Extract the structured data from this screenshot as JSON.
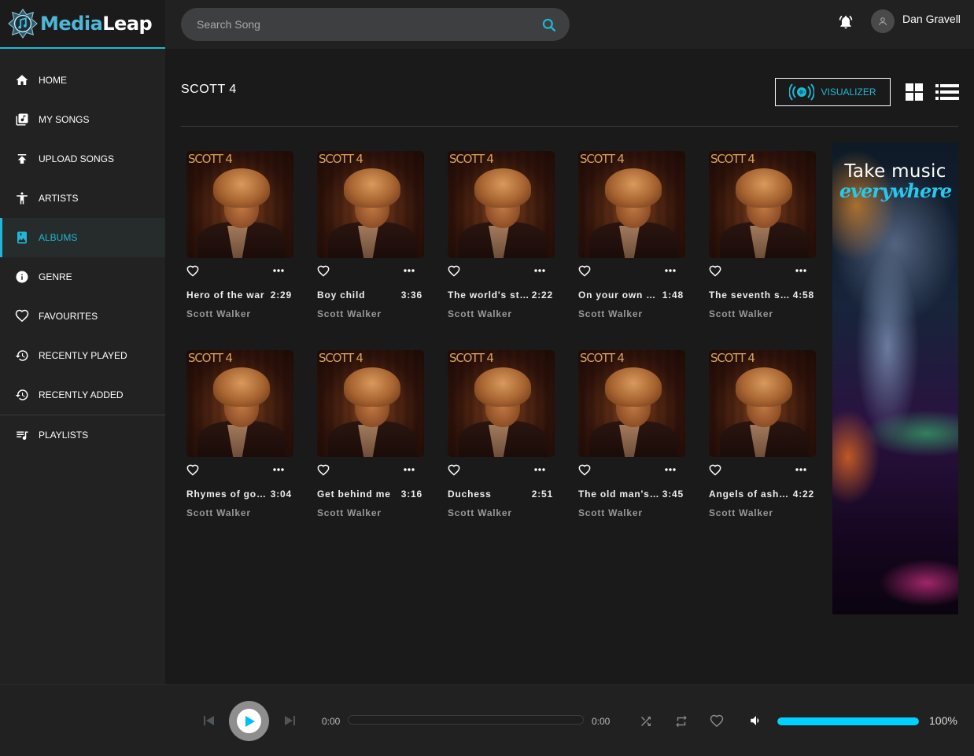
{
  "app": {
    "name_part1": "Media",
    "name_part2": "Leap"
  },
  "search": {
    "placeholder": "Search Song",
    "value": ""
  },
  "user": {
    "name": "Dan Gravell"
  },
  "sidebar": {
    "items": [
      {
        "label": "HOME",
        "icon": "home-icon",
        "active": false
      },
      {
        "label": "MY SONGS",
        "icon": "library-music-icon",
        "active": false
      },
      {
        "label": "UPLOAD SONGS",
        "icon": "upload-icon",
        "active": false
      },
      {
        "label": "ARTISTS",
        "icon": "person-icon",
        "active": false
      },
      {
        "label": "ALBUMS",
        "icon": "album-icon",
        "active": true
      },
      {
        "label": "GENRE",
        "icon": "info-icon",
        "active": false
      },
      {
        "label": "FAVOURITES",
        "icon": "heart-icon",
        "active": false
      },
      {
        "label": "RECENTLY PLAYED",
        "icon": "history-icon",
        "active": false
      },
      {
        "label": "RECENTLY ADDED",
        "icon": "history-icon",
        "active": false
      },
      {
        "label": "PLAYLISTS",
        "icon": "playlist-icon",
        "active": false
      }
    ]
  },
  "main": {
    "title": "SCOTT 4",
    "visualizer_label": "VISUALIZER",
    "cover_label": "SCOTT 4",
    "songs": [
      {
        "title": "Hero of the war",
        "duration": "2:29",
        "artist": "Scott Walker"
      },
      {
        "title": "Boy child",
        "duration": "3:36",
        "artist": "Scott Walker"
      },
      {
        "title": "The world's str…",
        "duration": "2:22",
        "artist": "Scott Walker"
      },
      {
        "title": "On your own ag…",
        "duration": "1:48",
        "artist": "Scott Walker"
      },
      {
        "title": "The seventh se…",
        "duration": "4:58",
        "artist": "Scott Walker"
      },
      {
        "title": "Rhymes of goo…",
        "duration": "3:04",
        "artist": "Scott Walker"
      },
      {
        "title": "Get behind me",
        "duration": "3:16",
        "artist": "Scott Walker"
      },
      {
        "title": "Duchess",
        "duration": "2:51",
        "artist": "Scott Walker"
      },
      {
        "title": "The old man's …",
        "duration": "3:45",
        "artist": "Scott Walker"
      },
      {
        "title": "Angels of ashes",
        "duration": "4:22",
        "artist": "Scott Walker"
      }
    ]
  },
  "ad": {
    "line1": "Take music",
    "line2": "everywhere"
  },
  "player": {
    "current_time": "0:00",
    "total_time": "0:00",
    "progress": 0,
    "volume_percent": 100,
    "volume_label": "100%"
  },
  "colors": {
    "accent": "#1fb8d6",
    "volume_fill": "#00d2ff"
  }
}
